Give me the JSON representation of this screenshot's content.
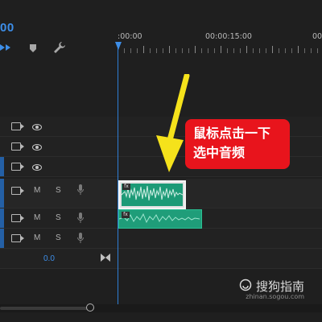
{
  "timecode": "00",
  "ruler": {
    "label_start": ":00:00",
    "label_mid": "00:00:15:00",
    "label_end": "00"
  },
  "tracks": [
    {
      "id": "video-3",
      "toggle_icon": "film-icon",
      "eye_icon": "eye-icon"
    },
    {
      "id": "video-2",
      "toggle_icon": "film-icon",
      "eye_icon": "eye-icon"
    },
    {
      "id": "video-1",
      "toggle_icon": "film-icon",
      "eye_icon": "eye-icon"
    },
    {
      "id": "audio-1",
      "mute": "M",
      "solo": "S",
      "mic_icon": "mic-icon"
    },
    {
      "id": "audio-2",
      "mute": "M",
      "solo": "S",
      "mic_icon": "mic-icon"
    },
    {
      "id": "audio-3",
      "mute": "M",
      "solo": "S",
      "mic_icon": "mic-icon"
    }
  ],
  "master": {
    "volume": "0.0"
  },
  "clips": {
    "audio1": {
      "label": "fx"
    },
    "audio2": {
      "label": "fx"
    }
  },
  "callout": {
    "line1": "鼠标点击一下",
    "line2": "选中音频"
  },
  "watermark": {
    "brand": "搜狗指南",
    "url": "zhinan.sogou.com"
  },
  "colors": {
    "accent": "#3d8ee8",
    "clip": "#1f9d79",
    "callout": "#e8141c",
    "arrow": "#f5e21b"
  }
}
